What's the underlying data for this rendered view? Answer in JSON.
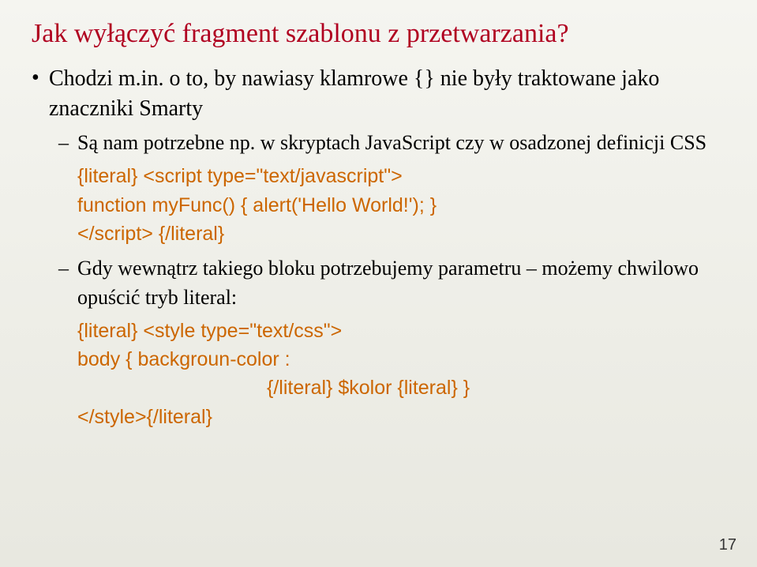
{
  "title": "Jak wyłączyć fragment szablonu z przetwarzania?",
  "bullet1": {
    "text": "Chodzi m.in. o to, by nawiasy klamrowe {} nie były traktowane jako znaczniki Smarty",
    "sub1": {
      "text": "Są nam potrzebne np. w skryptach JavaScript czy w osadzonej definicji CSS",
      "code_line1": "{literal} <script type=\"text/javascript\">",
      "code_line2": "function myFunc() { alert('Hello World!'); }",
      "code_line3": "</script> {/literal}"
    },
    "sub2": {
      "text": "Gdy wewnątrz takiego bloku potrzebujemy parametru – możemy chwilowo opuścić tryb literal:",
      "code_line1": "{literal} <style type=\"text/css\">",
      "code_line2": "body { backgroun-color :",
      "code_line3": "{/literal} $kolor {literal} }",
      "code_line4": "</style>{/literal}"
    }
  },
  "page_number": "17"
}
